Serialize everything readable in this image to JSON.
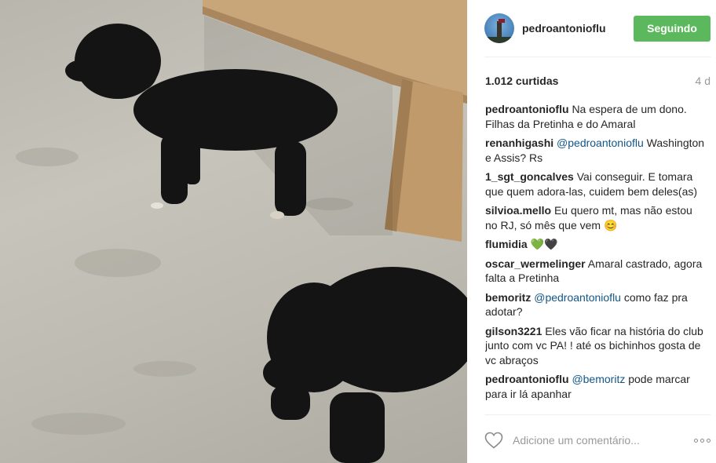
{
  "post": {
    "image_alt": "Dois filhotes pretos no chão de cimento",
    "colors": {
      "floor": "#bdbab1",
      "wood": "#c9a57a",
      "puppy": "#141414"
    }
  },
  "header": {
    "username": "pedroantonioflu",
    "follow_label": "Seguindo",
    "follow_color": "#5cb85c",
    "avatar_icon": "avatar-tower-icon"
  },
  "stats": {
    "likes": "1.012 curtidas",
    "time": "4 d"
  },
  "comments": [
    {
      "author": "pedroantonioflu",
      "mention": "",
      "text": "Na espera de um dono. Filhas da Pretinha e do Amaral"
    },
    {
      "author": "renanhigashi",
      "mention": "@pedroantonioflu",
      "text": "Washington e Assis? Rs"
    },
    {
      "author": "1_sgt_goncalves",
      "mention": "",
      "text": "Vai conseguir. E tomara que quem adora-las, cuidem bem deles(as)"
    },
    {
      "author": "silvioa.mello",
      "mention": "",
      "text": "Eu quero mt, mas não estou no RJ, só mês que vem 😊"
    },
    {
      "author": "flumidia",
      "mention": "",
      "text": "💚🖤"
    },
    {
      "author": "oscar_wermelinger",
      "mention": "",
      "text": "Amaral castrado, agora falta a Pretinha"
    },
    {
      "author": "bemoritz",
      "mention": "@pedroantonioflu",
      "text": "como faz pra adotar?"
    },
    {
      "author": "gilson3221",
      "mention": "",
      "text": "Eles vão ficar na história do club junto com vc PA! ! até os bichinhos gosta de vc abraços"
    },
    {
      "author": "pedroantonioflu",
      "mention": "@bemoritz",
      "text": "pode marcar para ir lá apanhar"
    }
  ],
  "footer": {
    "comment_placeholder": "Adicione um comentário...",
    "like_icon": "heart-icon",
    "more_icon": "more-options-icon"
  }
}
